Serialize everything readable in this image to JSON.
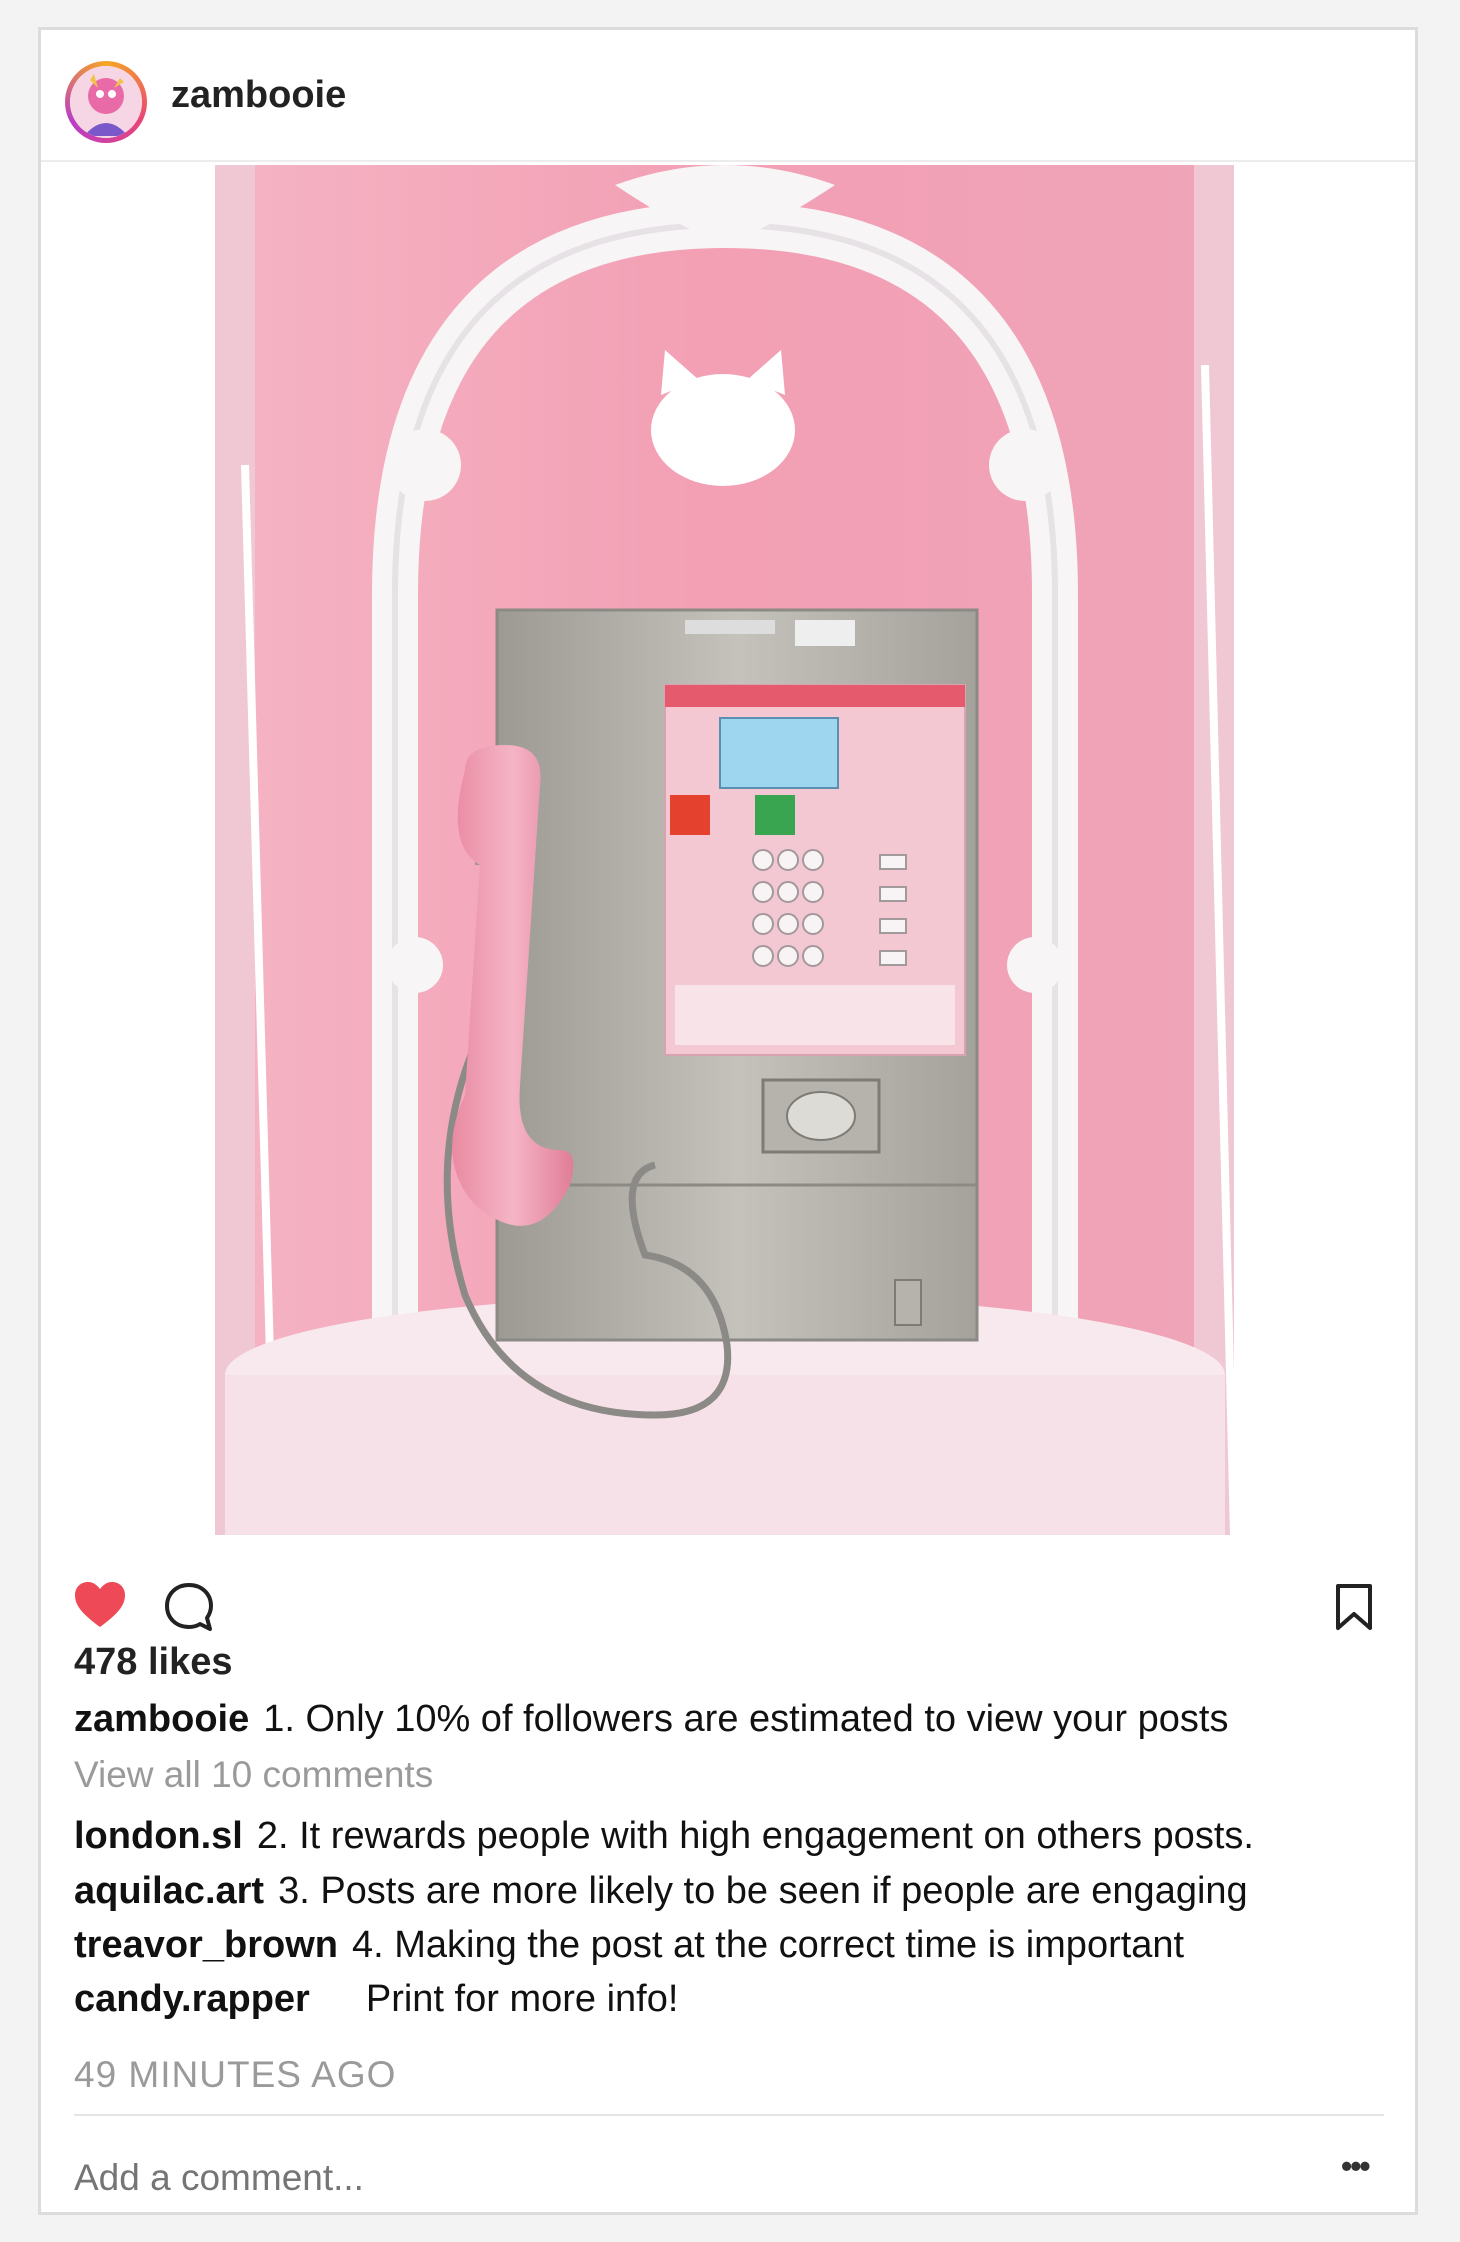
{
  "post": {
    "username": "zambooie",
    "likes": "478 likes",
    "caption": {
      "user": "zambooie",
      "text": "1. Only 10% of followers are estimated to view your posts"
    },
    "view_all": "View all 10 comments",
    "comments": [
      {
        "user": "london.sl",
        "text": "2. It rewards people with high engagement on others posts."
      },
      {
        "user": "aquilac.art",
        "text": "3. Posts are more likely to be seen if people are engaging"
      },
      {
        "user": "treavor_brown",
        "text": "4. Making the post at the correct time is important"
      },
      {
        "user": "candy.rapper",
        "text": "Print for more info!"
      }
    ],
    "time": "49 MINUTES AGO",
    "add_comment_placeholder": "Add a comment...",
    "more_label": "•••"
  },
  "icons": {
    "like": "heart-icon",
    "comment": "comment-icon",
    "save": "bookmark-icon",
    "more": "more-icon"
  },
  "colors": {
    "like_red": "#ed4956",
    "muted_text": "#9a9a9a",
    "wall_pink": "#f2a9b9"
  }
}
